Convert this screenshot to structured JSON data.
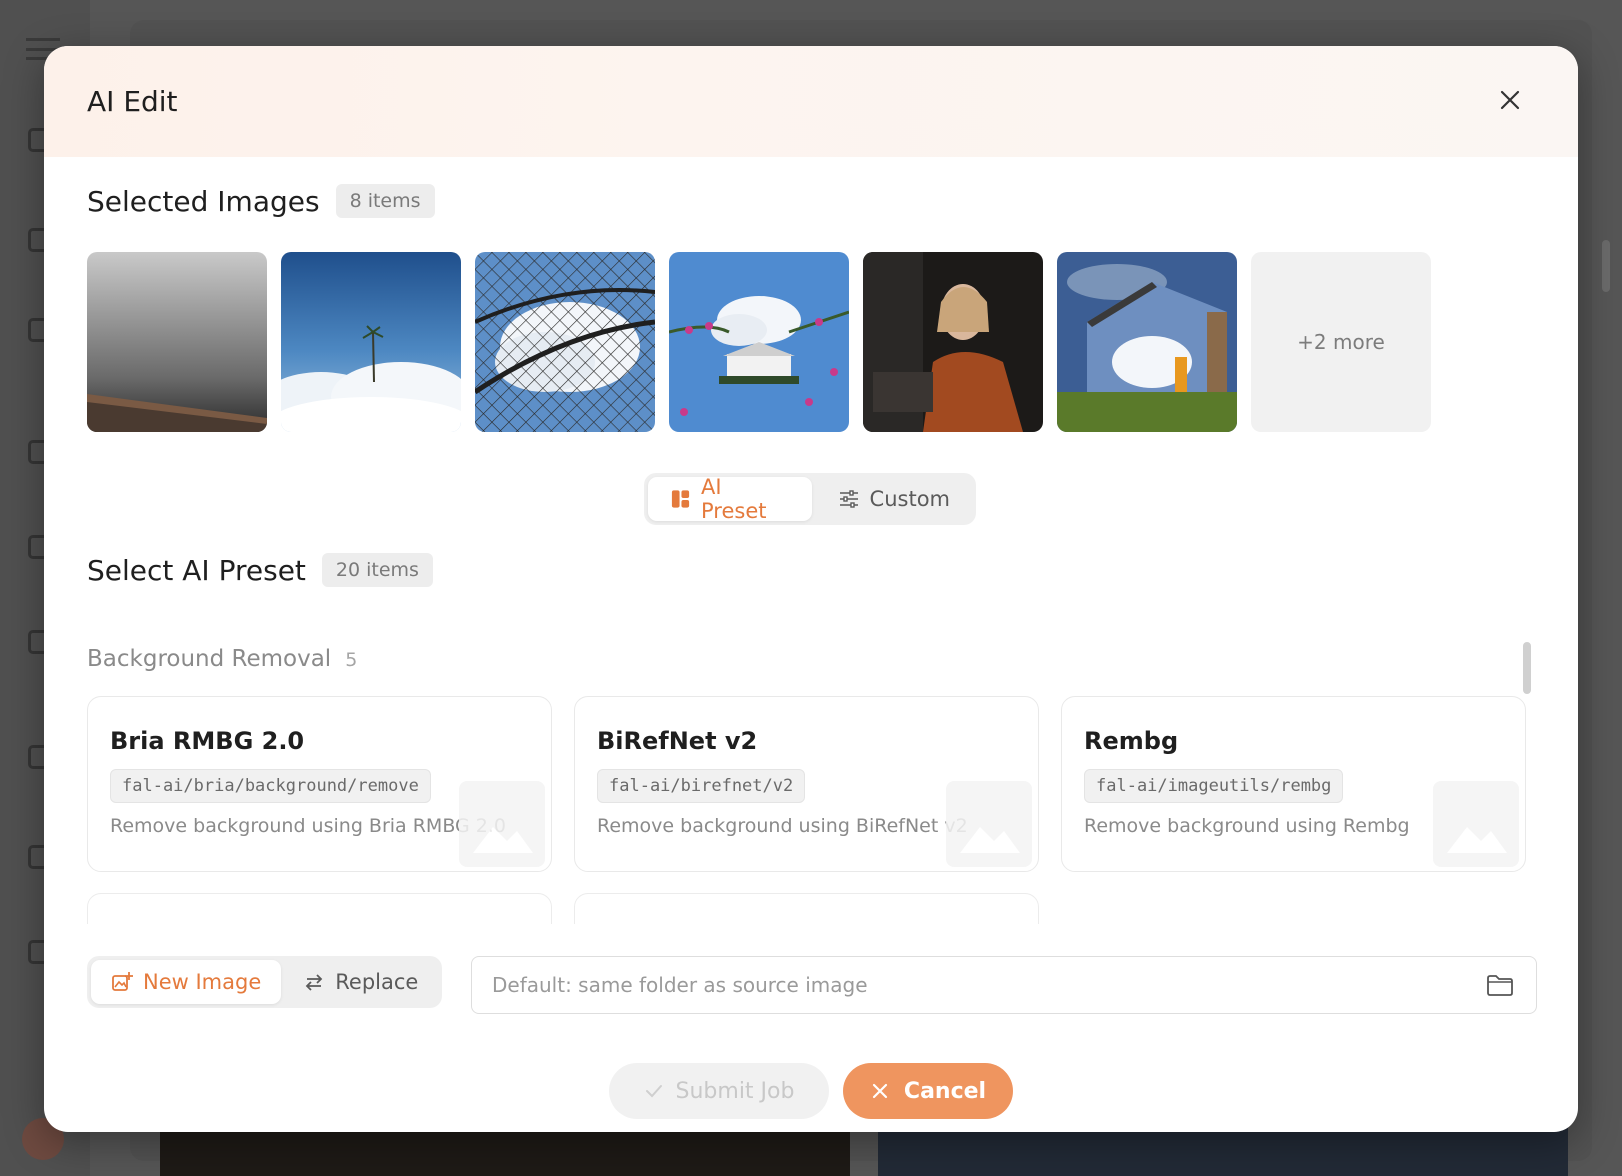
{
  "modal": {
    "title": "AI Edit"
  },
  "selected_images": {
    "title": "Selected Images",
    "count_badge": "8 items",
    "thumbnails": [
      {
        "icon": "gray-gradient-roof-image"
      },
      {
        "icon": "palm-tree-clouds-image"
      },
      {
        "icon": "fence-clouds-image"
      },
      {
        "icon": "floating-house-flowers-image"
      },
      {
        "icon": "woman-portrait-image"
      },
      {
        "icon": "mirror-house-cloud-image"
      }
    ],
    "more_label": "+2 more"
  },
  "mode_toggle": {
    "ai_preset_label": "AI Preset",
    "custom_label": "Custom",
    "selected": "AI Preset"
  },
  "preset_section": {
    "title": "Select AI Preset",
    "count_badge": "20 items",
    "group": {
      "name": "Background Removal",
      "count": "5"
    },
    "presets": [
      {
        "name": "Bria RMBG 2.0",
        "endpoint": "fal-ai/bria/background/remove",
        "description": "Remove background using Bria RMBG 2.0"
      },
      {
        "name": "BiRefNet v2",
        "endpoint": "fal-ai/birefnet/v2",
        "description": "Remove background using BiRefNet v2"
      },
      {
        "name": "Rembg",
        "endpoint": "fal-ai/imageutils/rembg",
        "description": "Remove background using Rembg"
      }
    ]
  },
  "output": {
    "new_image_label": "New Image",
    "replace_label": "Replace",
    "selected": "New Image",
    "folder_placeholder": "Default: same folder as source image",
    "folder_value": ""
  },
  "actions": {
    "submit_label": "Submit Job",
    "cancel_label": "Cancel"
  },
  "colors": {
    "accent": "#e47a3c",
    "cancel_bg": "#ef955f"
  }
}
